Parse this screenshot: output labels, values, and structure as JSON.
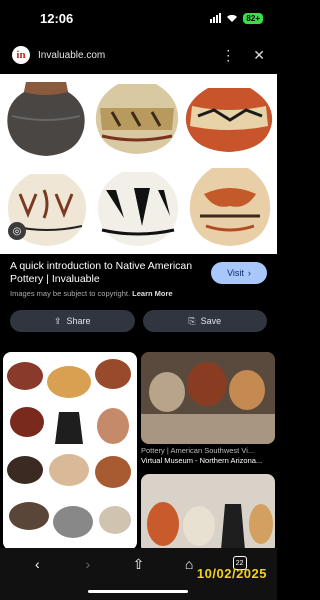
{
  "status": {
    "time": "12:06",
    "battery": "82+"
  },
  "site": {
    "name": "Invaluable.com",
    "logo": "in"
  },
  "icons": {
    "more": "more-vert-icon",
    "close": "close-icon",
    "lens": "lens-icon",
    "share": "share-icon",
    "save": "bookmark-icon",
    "back": "back-icon",
    "forward": "forward-icon",
    "share_nav": "share-up-icon",
    "home": "home-icon"
  },
  "result": {
    "title": "A quick introduction to Native American Pottery | Invaluable",
    "note": "Images may be subject to copyright.",
    "learn_more": "Learn More",
    "visit_label": "Visit"
  },
  "actions": {
    "share_label": "Share",
    "save_label": "Save"
  },
  "related": {
    "caption_source": "Pottery | American Southwest Vi...",
    "caption_title": "Virtual Museum - Northern Arizona..."
  },
  "nav": {
    "tabs_count": "22"
  },
  "datestamp": "10/02/2025",
  "colors": {
    "visit_bg": "#a8c7fa",
    "action_bg": "#303540",
    "battery": "#3ddc4a",
    "datestamp": "#f2d21b"
  }
}
